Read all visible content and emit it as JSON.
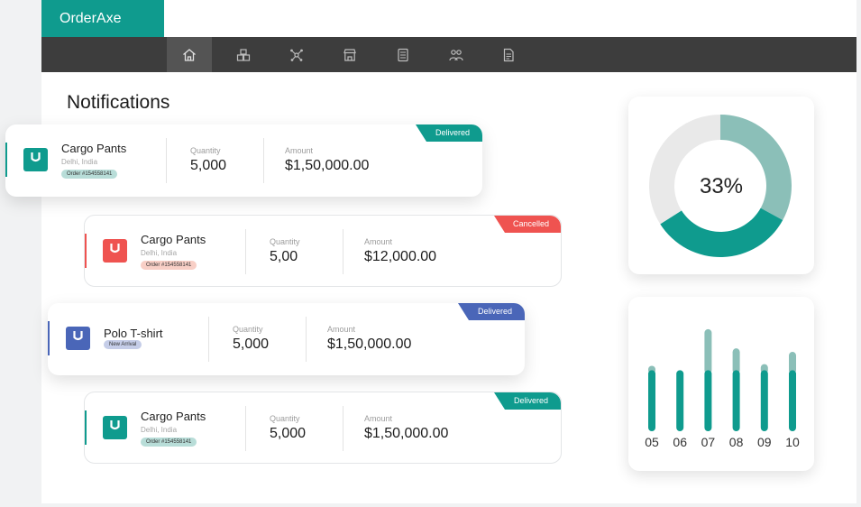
{
  "app": {
    "name": "OrderAxe"
  },
  "nav": {
    "items": [
      {
        "name": "home",
        "icon": "home-icon",
        "active": true
      },
      {
        "name": "products",
        "icon": "boxes-icon",
        "active": false
      },
      {
        "name": "network",
        "icon": "network-icon",
        "active": false
      },
      {
        "name": "store",
        "icon": "store-icon",
        "active": false
      },
      {
        "name": "orders",
        "icon": "checklist-icon",
        "active": false
      },
      {
        "name": "customers",
        "icon": "users-icon",
        "active": false
      },
      {
        "name": "reports",
        "icon": "document-icon",
        "active": false
      }
    ]
  },
  "page": {
    "title": "Notifications"
  },
  "labels": {
    "quantity": "Quantity",
    "amount": "Amount"
  },
  "notifications": [
    {
      "product": "Cargo Pants",
      "location": "Delhi, India",
      "tag": "Order #154558141",
      "quantity": "5,000",
      "amount": "$1,50,000.00",
      "status": "Delivered",
      "color": "#0f9b8e",
      "tag_bg": "#b8ddd8"
    },
    {
      "product": "Cargo Pants",
      "location": "Delhi, India",
      "tag": "Order #154558141",
      "quantity": "5,00",
      "amount": "$12,000.00",
      "status": "Cancelled",
      "color": "#ef5350",
      "tag_bg": "#f8cfc6"
    },
    {
      "product": "Polo T-shirt",
      "location": "",
      "tag": "New Arrival",
      "quantity": "5,000",
      "amount": "$1,50,000.00",
      "status": "Delivered",
      "color": "#4a66b8",
      "tag_bg": "#c5cde8"
    },
    {
      "product": "Cargo Pants",
      "location": "Delhi, India",
      "tag": "Order #154558141",
      "quantity": "5,000",
      "amount": "$1,50,000.00",
      "status": "Delivered",
      "color": "#0f9b8e",
      "tag_bg": "#b8ddd8"
    }
  ],
  "donut": {
    "label": "33%",
    "segments": [
      {
        "value": 33,
        "color": "#8bbfb8"
      },
      {
        "value": 33,
        "color": "#0f9b8e"
      },
      {
        "value": 34,
        "color": "#e9e9e9"
      }
    ]
  },
  "chart_data": {
    "type": "bar",
    "categories": [
      "05",
      "06",
      "07",
      "08",
      "09",
      "10"
    ],
    "series": [
      {
        "values": [
          70,
          70,
          70,
          70,
          70,
          70
        ],
        "color": "#0f9b8e"
      },
      {
        "values": [
          5,
          0,
          47,
          25,
          7,
          21
        ],
        "color": "#8bbfb8"
      }
    ],
    "stacked": true,
    "ylim": [
      0,
      120
    ],
    "grid": false
  }
}
